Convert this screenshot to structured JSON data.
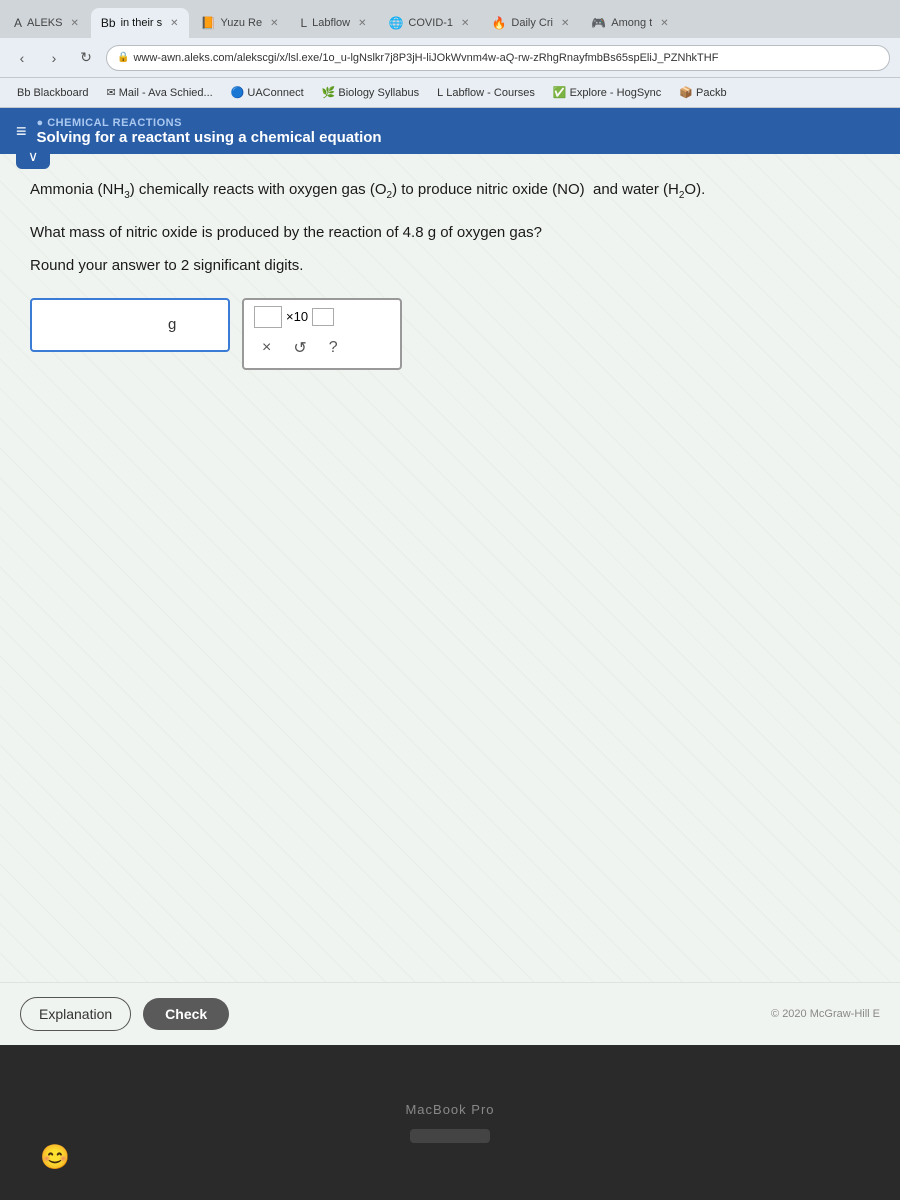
{
  "browser": {
    "tabs": [
      {
        "id": "aleks",
        "label": "ALEKS",
        "icon": "A",
        "active": false
      },
      {
        "id": "bb",
        "label": "in their s",
        "icon": "Bb",
        "active": true
      },
      {
        "id": "yuzu",
        "label": "Yuzu Re",
        "icon": "📙",
        "active": false
      },
      {
        "id": "labflow",
        "label": "Labflow",
        "icon": "L",
        "active": false
      },
      {
        "id": "covid",
        "label": "COVID-1",
        "icon": "🌐",
        "active": false
      },
      {
        "id": "daily",
        "label": "Daily Cri",
        "icon": "🔥",
        "active": false
      },
      {
        "id": "among",
        "label": "Among t",
        "icon": "🎮",
        "active": false
      }
    ],
    "address": "www-awn.aleks.com/alekscgi/x/lsl.exe/1o_u-lgNslkr7j8P3jH-liJOkWvnm4w-aQ-rw-zRhgRnayfmbBs65spEliJ_PZNhkTHF",
    "bookmarks": [
      {
        "label": "Blackboard",
        "icon": "Bb"
      },
      {
        "label": "Mail - Ava Schied...",
        "icon": "✉"
      },
      {
        "label": "UAConnect",
        "icon": "🔵"
      },
      {
        "label": "Biology Syllabus",
        "icon": "🌿"
      },
      {
        "label": "Labflow - Courses",
        "icon": "L"
      },
      {
        "label": "Explore - HogSync",
        "icon": "✅"
      },
      {
        "label": "Packb",
        "icon": "📦"
      }
    ]
  },
  "aleks": {
    "topic": "CHEMICAL REACTIONS",
    "title": "Solving for a reactant using a chemical equation",
    "question_line1": "Ammonia (NH₃) chemically reacts with oxygen gas (O₂) to produce nitric oxide (NO) and water (H₂O).",
    "question_line2": "What mass of nitric oxide is produced by the reaction of 4.8 g of oxygen gas?",
    "question_line3": "Round your answer to 2 significant digits.",
    "answer_unit": "g",
    "sci_notation_label": "×10",
    "buttons": {
      "explanation": "Explanation",
      "check": "Check",
      "x_btn": "×",
      "undo_btn": "↺",
      "help_btn": "?"
    },
    "copyright": "© 2020 McGraw-Hill E"
  },
  "macbook": {
    "label": "MacBook Pro"
  }
}
